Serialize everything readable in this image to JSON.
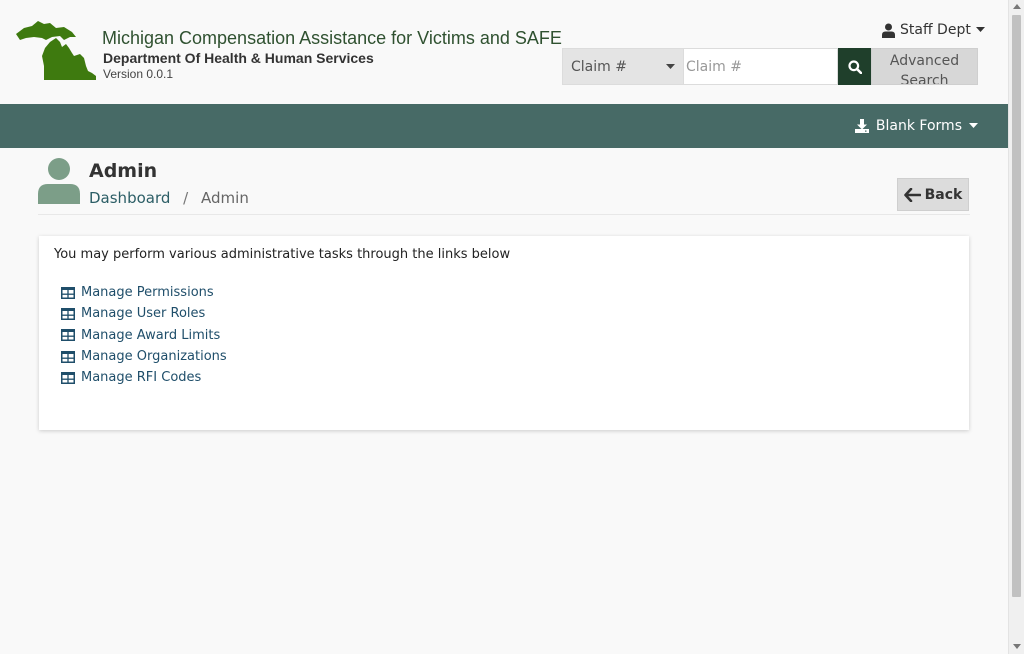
{
  "header": {
    "app_title": "Michigan Compensation Assistance for Victims and SAFE",
    "department": "Department Of Health & Human Services",
    "version": "Version 0.0.1",
    "user_menu_label": "Staff Dept"
  },
  "search": {
    "select_value": "Claim #",
    "input_placeholder": "Claim #",
    "advanced_label": "Advanced Search"
  },
  "navbar": {
    "blank_forms_label": "Blank Forms"
  },
  "page": {
    "title": "Admin",
    "breadcrumb": [
      "Dashboard",
      "Admin"
    ],
    "back_label": "Back"
  },
  "card": {
    "intro": "You may perform various administrative tasks through the links below",
    "links": [
      {
        "label": "Manage Permissions",
        "icon": "table-icon"
      },
      {
        "label": "Manage User Roles",
        "icon": "table-icon"
      },
      {
        "label": "Manage Award Limits",
        "icon": "table-icon"
      },
      {
        "label": "Manage Organizations",
        "icon": "table-icon"
      },
      {
        "label": "Manage RFI Codes",
        "icon": "table-icon"
      }
    ]
  },
  "colors": {
    "brand_green": "#476a66",
    "logo_green": "#3e7a0f",
    "title_green": "#2f5130",
    "search_button": "#1f3f2b",
    "link_blue": "#1f4e6a",
    "avatar": "#7c9e88"
  }
}
